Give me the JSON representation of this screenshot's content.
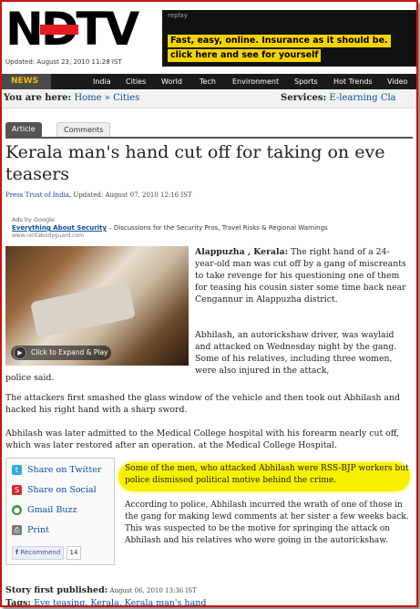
{
  "header": {
    "logo_text": "NDTV",
    "updated": "Updated: August 23, 2010 11:28 IST",
    "ad_replay": "replay",
    "ad_line1": "Fast, easy, online. Insurance as it should be.",
    "ad_line2": "click here and see for yourself"
  },
  "nav": {
    "news": "NEWS",
    "items": [
      "India",
      "Cities",
      "World",
      "Tech",
      "Environment",
      "Sports",
      "Hot Trends",
      "Video"
    ]
  },
  "breadcrumb": {
    "label": "You are here:",
    "home": "Home",
    "sep": "»",
    "cities": "Cities",
    "services_label": "Services:",
    "services_link": "E-learning",
    "services_more": "Cla"
  },
  "tabs": {
    "article": "Article",
    "comments": "Comments"
  },
  "article": {
    "title": "Kerala man's hand cut off for taking on eve teasers",
    "source": "Press Trust of India",
    "updated": ", Updated: August 07, 2010 12:16 IST",
    "ads_by": "Ads by Google",
    "ad_link": "Everything About Security",
    "ad_desc": " – Discussions for the Security Pros, Travel Risks & Regional Warnings",
    "ad_url": "www.rentabodyguard.com",
    "video_label": "Click to Expand & Play",
    "dateline": "Alappuzha , Kerala:",
    "p1": " The right hand of a 24-year-old man was cut off by a gang of miscreants to take revenge for his questioning one of them for teasing his cousin sister some time back near Cengannur in Alappuzha district.",
    "p2": "Abhilash, an autorickshaw driver, was waylaid and attacked on Wednesday night by the gang. Some of his relatives, including three women, were also injured in the attack,",
    "p2_cont": "police said.",
    "p3": "The attackers first smashed the glass window of the vehicle and then took out Abhilash and hacked his right hand with a sharp sword.",
    "p4": "Abhilash was later admitted to the Medical College hospital with his forearm nearly cut off, which was later restored after an operation. at the Medical College Hospital.",
    "highlight": "Some of the men, who attacked Abhilash were RSS-BJP workers but police dismissed political motive behind the crime.",
    "p6": "According to police, Abhilash incurred the wrath of one of those in the gang for making lewd comments at her sister a few weeks back. This was suspected to be the motive for springing the attack on Abhilash and his relatives who were going in the autorickshaw.",
    "first_published_label": "Story first published:",
    "first_published": " August 06, 2010 13:36 IST",
    "tags_label": "Tags: ",
    "tags": "Eve teasing, Kerala, Kerala man's hand"
  },
  "share": {
    "twitter": "Share on Twitter",
    "social": "Share on Social",
    "buzz": "Gmail Buzz",
    "print": "Print",
    "recommend": "Recommend",
    "count": "14"
  },
  "colors": {
    "accent_red": "#e21c21",
    "ad_yellow": "#f5d300",
    "link_blue": "#0b4ea2",
    "highlight_yellow": "#f8f000"
  }
}
